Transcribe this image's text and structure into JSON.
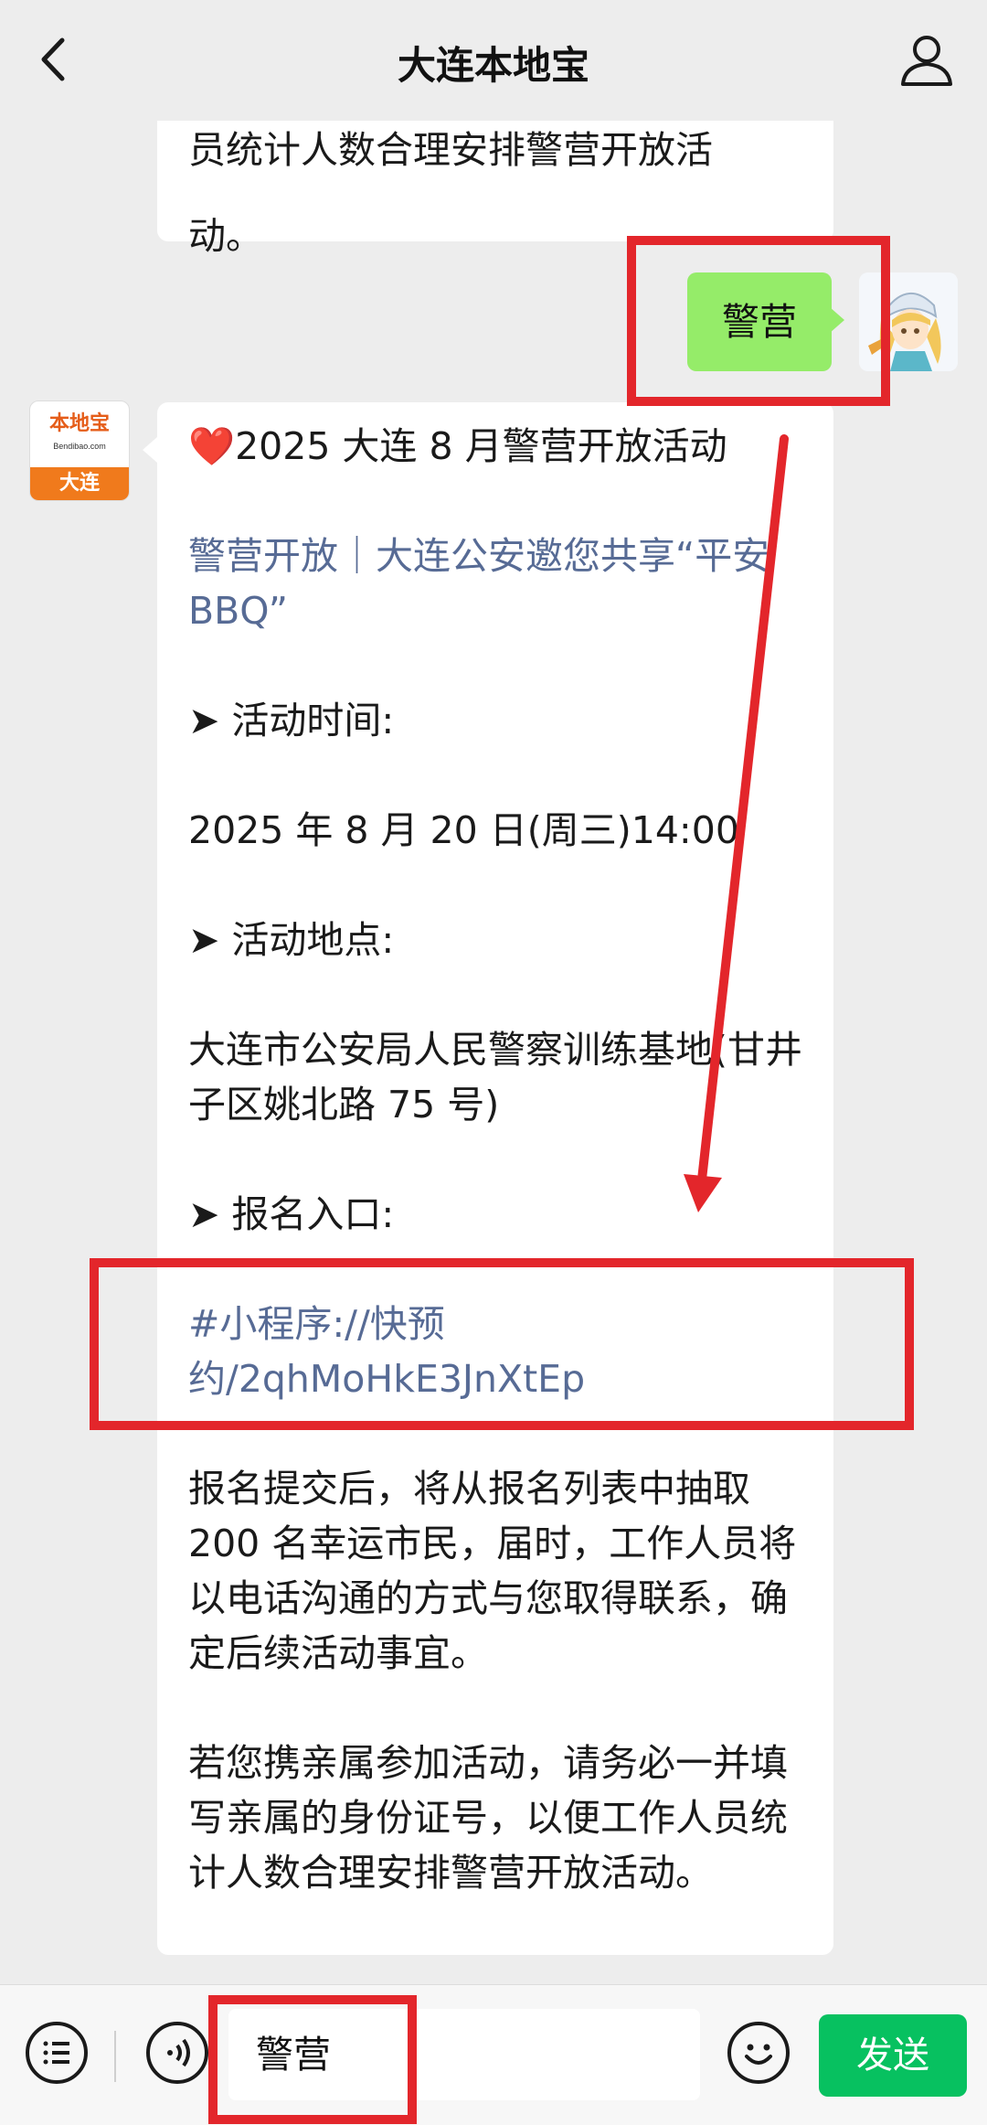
{
  "header": {
    "title": "大连本地宝"
  },
  "top_bubble": {
    "lines": [
      "员统计人数合理安排警营开放活",
      "动。"
    ]
  },
  "user_message": {
    "text": "警营"
  },
  "bot": {
    "avatar_top": "本地宝",
    "avatar_sub": "Bendibao.com",
    "avatar_bottom": "大连"
  },
  "bot_message": {
    "heart": "❤️",
    "headline": "2025 大连 8 月警营开放活动",
    "article_link": "警营开放｜大连公安邀您共享“平安 BBQ”",
    "time_label": "➤ 活动时间:",
    "time_value": "2025 年 8 月 20 日(周三)14:00",
    "place_label": "➤ 活动地点:",
    "place_value": "大连市公安局人民警察训练基地(甘井子区姚北路 75 号)",
    "signup_label": "➤ 报名入口:",
    "signup_link": "#小程序://快预约/2qhMoHkE3JnXtEp",
    "signup_note": "报名提交后，将从报名列表中抽取200 名幸运市民，届时，工作人员将以电话沟通的方式与您取得联系，确定后续活动事宜。",
    "family_note": "若您携亲属参加活动，请务必一并填写亲属的身份证号，以便工作人员统计人数合理安排警营开放活动。"
  },
  "input_bar": {
    "value": "警营",
    "send_label": "发送"
  },
  "colors": {
    "accent_green": "#07c160",
    "bubble_green": "#95ec69",
    "link_blue": "#576b95",
    "annotation_red": "#e3262b"
  }
}
